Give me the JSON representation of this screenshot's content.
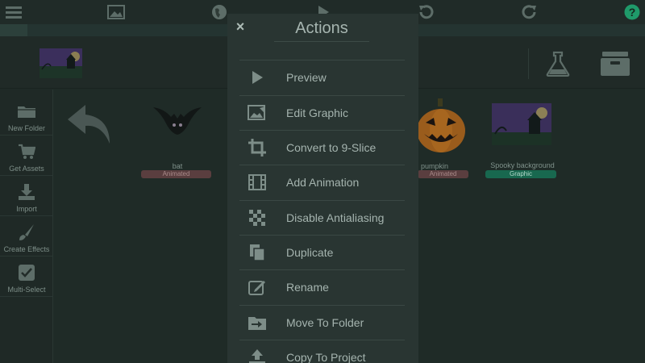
{
  "toolbar": {
    "icons": [
      "menu-icon",
      "image-icon",
      "globe-icon",
      "play-icon",
      "undo-icon",
      "redo-icon",
      "help-icon"
    ]
  },
  "tools": [
    {
      "label": "New Folder",
      "icon": "folder-icon"
    },
    {
      "label": "Get Assets",
      "icon": "cart-icon"
    },
    {
      "label": "Import",
      "icon": "download-icon"
    },
    {
      "label": "Create Effects",
      "icon": "brush-icon"
    },
    {
      "label": "Multi-Select",
      "icon": "checkbox-icon"
    }
  ],
  "assets": [
    {
      "name": "bat",
      "badge": "Animated"
    },
    {
      "name": "pumpkin",
      "badge": "Animated"
    },
    {
      "name": "Spooky background",
      "badge": "Graphic"
    }
  ],
  "modal": {
    "close": "×",
    "title": "Actions",
    "actions": [
      {
        "label": "Preview",
        "icon": "play-icon"
      },
      {
        "label": "Edit Graphic",
        "icon": "image-edit-icon"
      },
      {
        "label": "Convert to 9-Slice",
        "icon": "crop-icon"
      },
      {
        "label": "Add Animation",
        "icon": "film-icon"
      },
      {
        "label": "Disable Antialiasing",
        "icon": "checker-icon"
      },
      {
        "label": "Duplicate",
        "icon": "copy-icon"
      },
      {
        "label": "Rename",
        "icon": "rename-icon"
      },
      {
        "label": "Move To Folder",
        "icon": "folder-move-icon"
      },
      {
        "label": "Copy To Project",
        "icon": "upload-icon"
      }
    ]
  },
  "colors": {
    "background": "#1f2b27",
    "modal": "#293532",
    "graphic_badge": "#18684f",
    "animated_badge": "#5a3e3f",
    "help": "#1f9a6a"
  }
}
